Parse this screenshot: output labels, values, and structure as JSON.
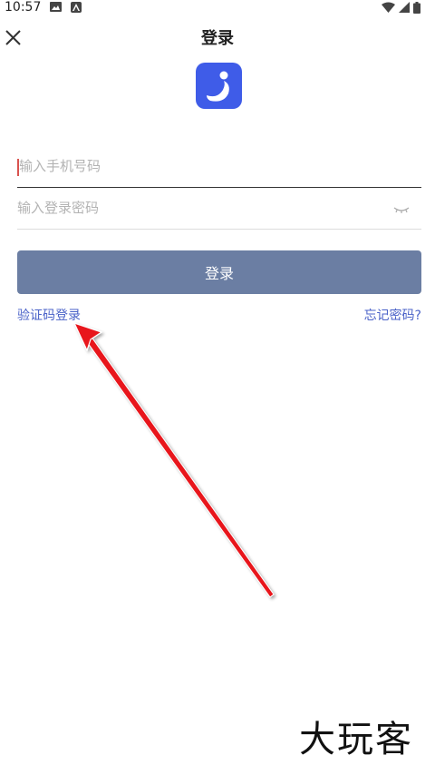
{
  "status_bar": {
    "time": "10:57"
  },
  "header": {
    "title": "登录"
  },
  "form": {
    "phone_placeholder": "输入手机号码",
    "password_placeholder": "输入登录密码",
    "login_label": "登录"
  },
  "links": {
    "code_login": "验证码登录",
    "forgot_password": "忘记密码?"
  },
  "watermark": "大玩客",
  "colors": {
    "logo_bg": "#3f5ce8",
    "login_button_bg": "#6b7ea3",
    "link": "#4a62c8",
    "arrow": "#e8161c"
  }
}
